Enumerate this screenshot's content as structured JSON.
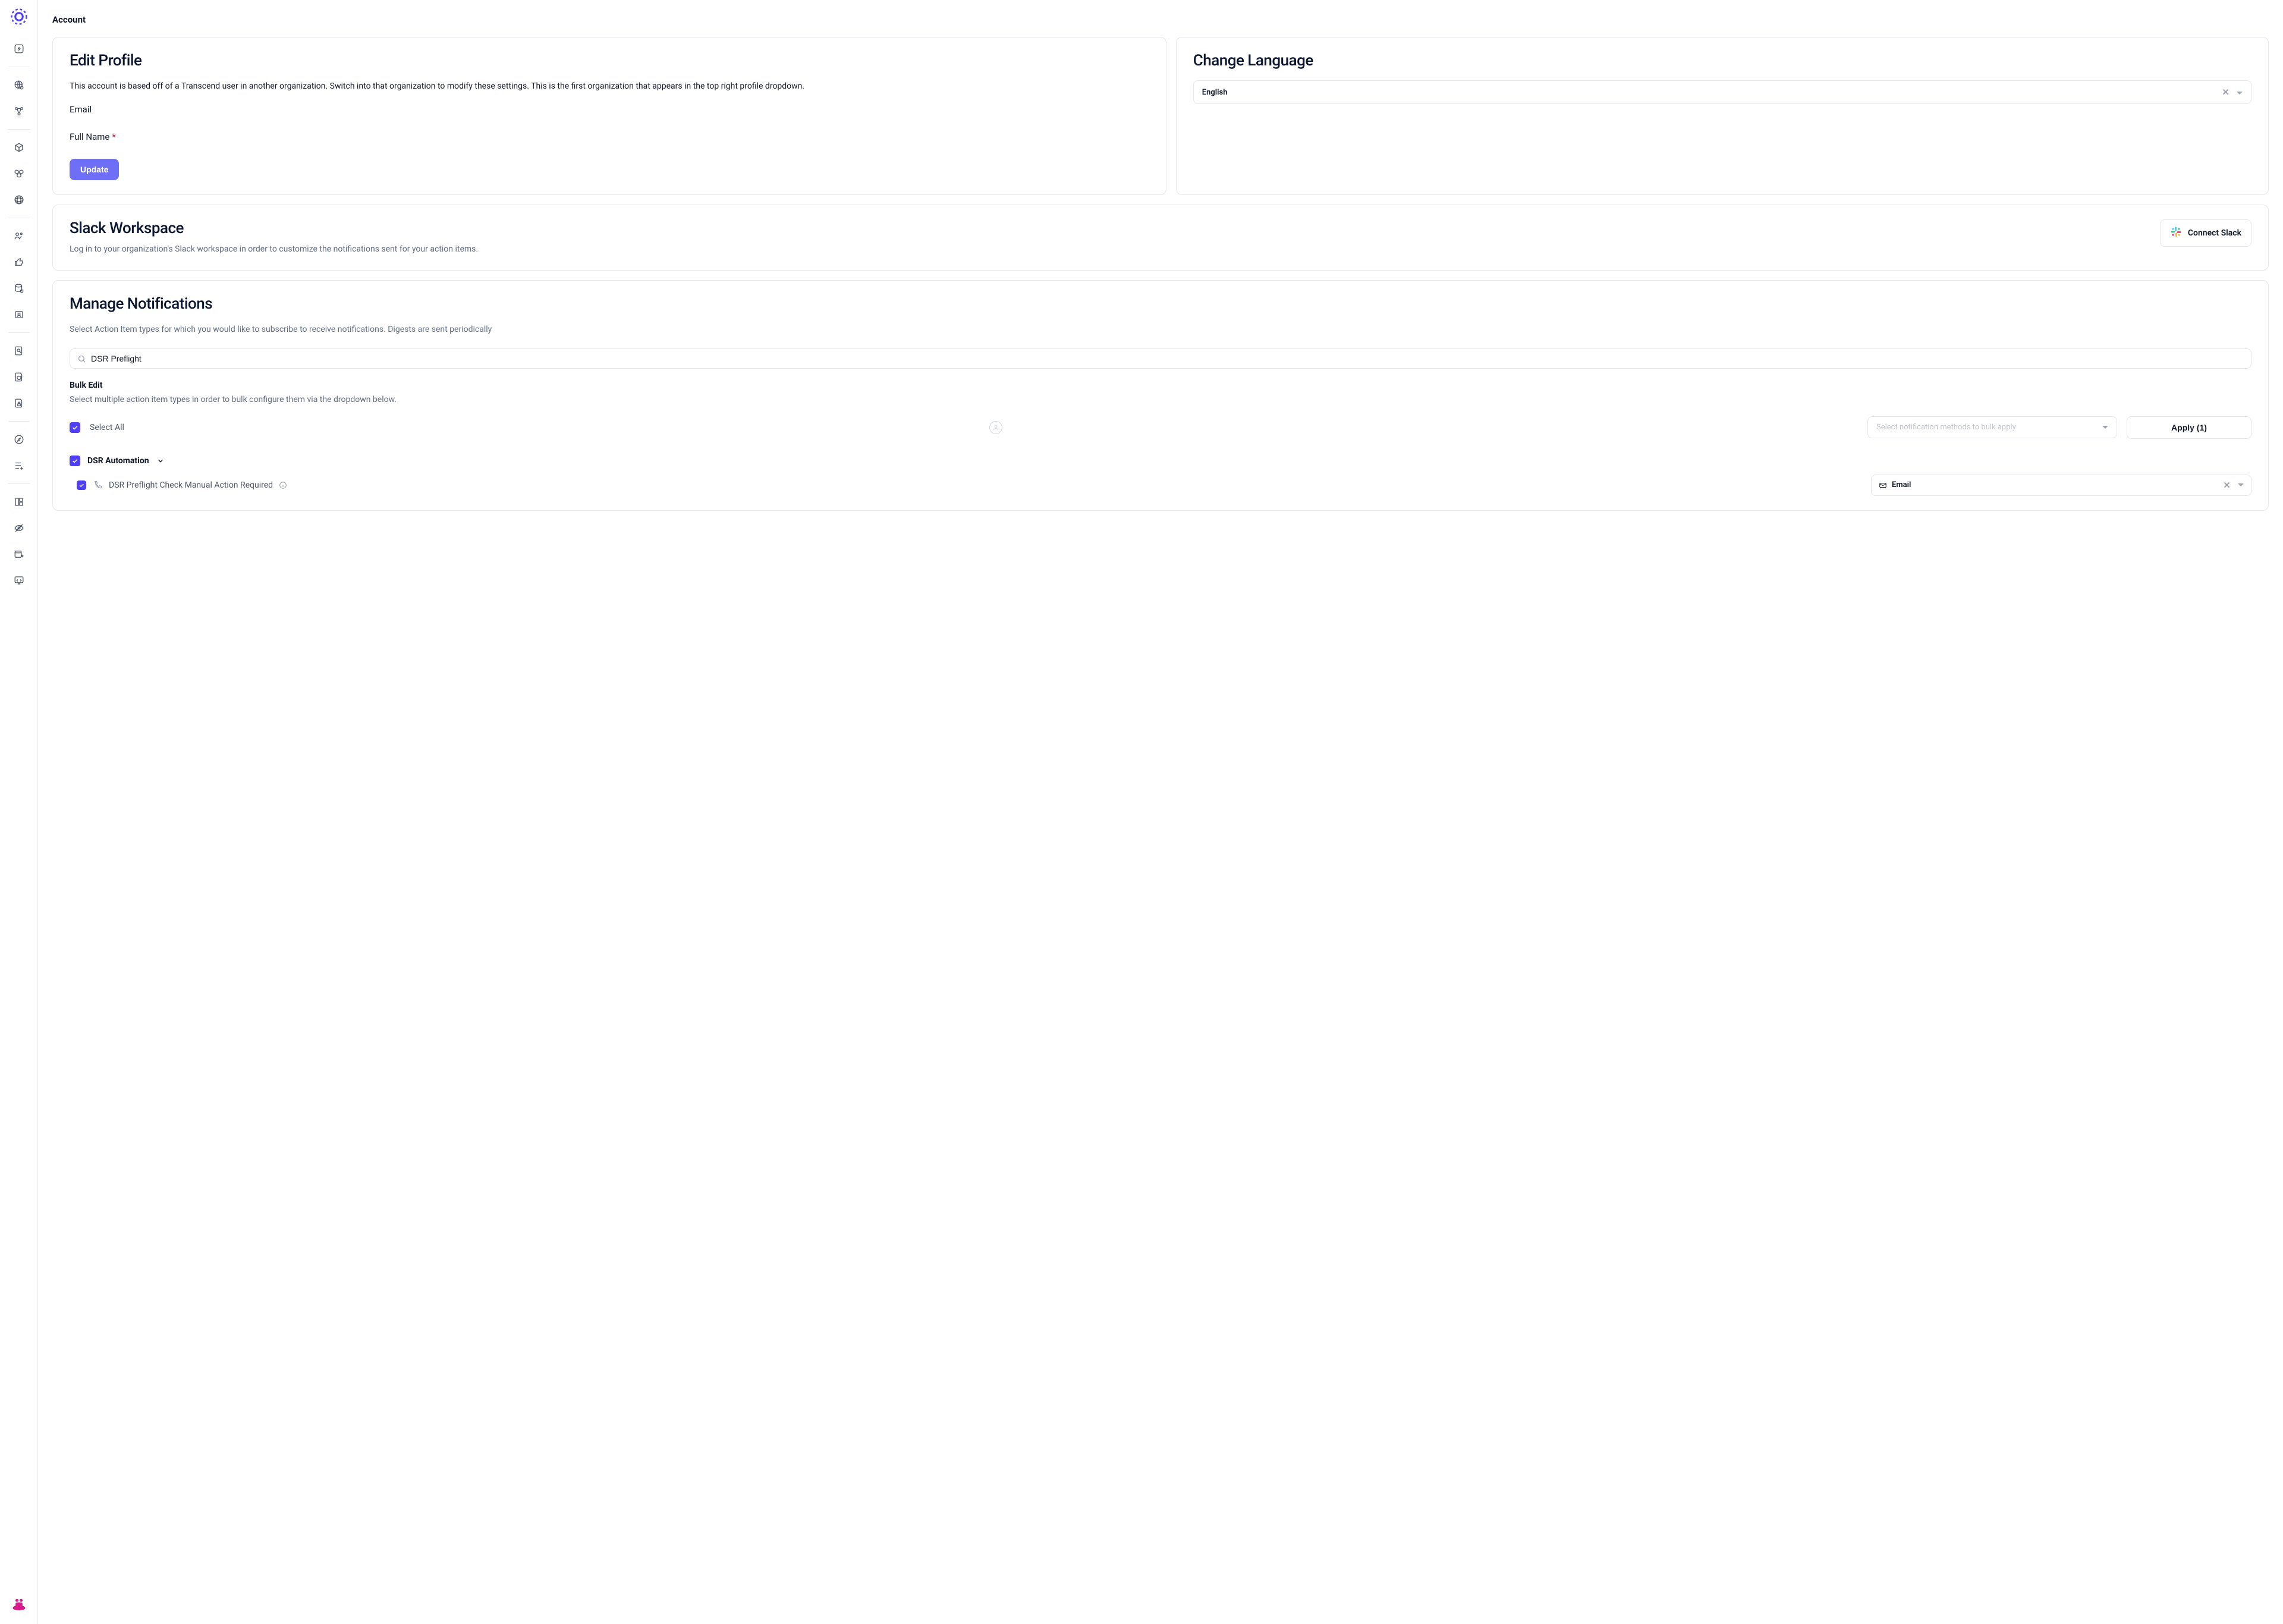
{
  "page": {
    "title": "Account"
  },
  "editProfile": {
    "title": "Edit Profile",
    "desc": "This account is based off of a Transcend user in another organization. Switch into that organization to modify these settings. This is the first organization that appears in the top right profile dropdown.",
    "emailLabel": "Email",
    "fullNameLabel": "Full Name",
    "updateButton": "Update"
  },
  "language": {
    "title": "Change Language",
    "value": "English"
  },
  "slack": {
    "title": "Slack Workspace",
    "desc": "Log in to your organization's Slack workspace in order to customize the notifications sent for your action items.",
    "connectButton": "Connect Slack"
  },
  "notifications": {
    "title": "Manage Notifications",
    "desc": "Select Action Item types for which you would like to subscribe to receive notifications. Digests are sent periodically",
    "searchValue": "DSR Preflight",
    "bulkEditTitle": "Bulk Edit",
    "bulkEditDesc": "Select multiple action item types in order to bulk configure them via the dropdown below.",
    "selectAllLabel": "Select All",
    "bulkPlaceholder": "Select notification methods to bulk apply",
    "applyButton": "Apply (1)",
    "group": {
      "title": "DSR Automation",
      "item": {
        "label": "DSR Preflight Check Manual Action Required",
        "value": "Email"
      }
    }
  }
}
